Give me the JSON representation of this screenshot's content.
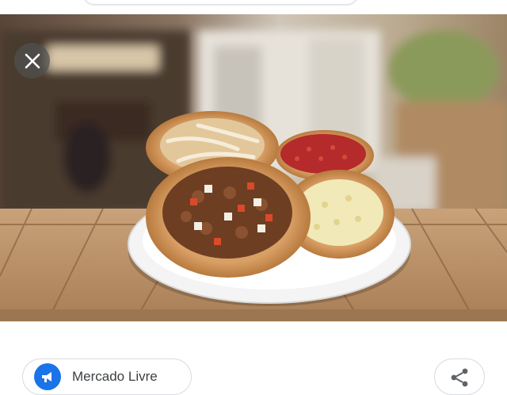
{
  "header": {
    "search_pill_text": ""
  },
  "viewer": {
    "close_icon": "close-icon",
    "image_subject": "pizza-plate-image"
  },
  "footer": {
    "source_label": "Mercado Livre",
    "source_icon": "megaphone-icon",
    "share_icon": "share-icon"
  },
  "colors": {
    "accent": "#1a73e8",
    "border": "#dadce0",
    "text": "#3c4043"
  }
}
